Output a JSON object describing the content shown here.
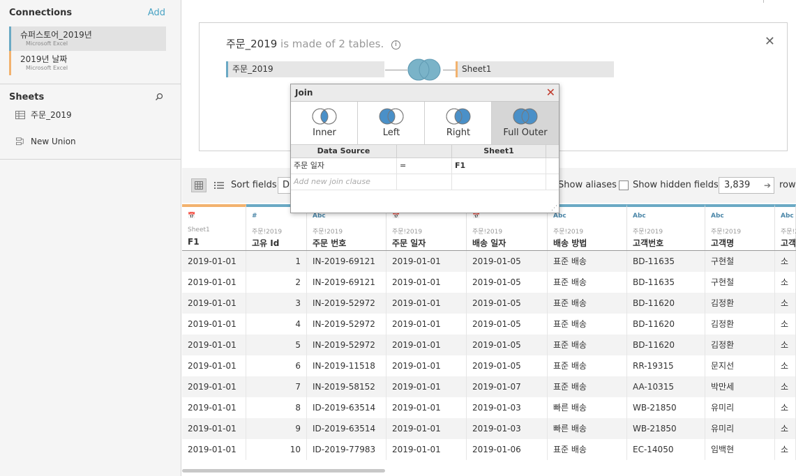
{
  "sidebar": {
    "connections_title": "Connections",
    "add_label": "Add",
    "connections": [
      {
        "name": "슈퍼스토어_2019년",
        "type": "Microsoft Excel"
      },
      {
        "name": "2019년 날짜",
        "type": "Microsoft Excel"
      }
    ],
    "sheets_title": "Sheets",
    "sheets": [
      {
        "name": "주문_2019",
        "icon": "grid-table-icon"
      },
      {
        "name": "New Union",
        "icon": "union-icon"
      }
    ]
  },
  "canvas": {
    "title_name": "주문_2019",
    "title_suffix": " is made of 2 tables.",
    "info_glyph": "i",
    "left_table": "주문_2019",
    "right_table": "Sheet1",
    "close_glyph": "✕"
  },
  "join_dialog": {
    "title": "Join",
    "close_glyph": "✕",
    "types": [
      {
        "label": "Inner",
        "selected": false
      },
      {
        "label": "Left",
        "selected": false
      },
      {
        "label": "Right",
        "selected": false
      },
      {
        "label": "Full Outer",
        "selected": true
      }
    ],
    "columns": {
      "left": "Data Source",
      "op": "",
      "right": "Sheet1"
    },
    "clauses": [
      {
        "left": "주문 일자",
        "op": "=",
        "right": "F1"
      }
    ],
    "add_clause_placeholder": "Add new join clause",
    "grip_glyph": "⋰"
  },
  "toolbar": {
    "sort_label": "Sort fields",
    "sort_value": "D",
    "show_aliases_label": "Show aliases",
    "show_hidden_label": "Show hidden fields",
    "show_hidden_checked": false,
    "rows_value": "3,839",
    "rows_arrow": "➔",
    "rows_label": "rows"
  },
  "grid": {
    "columns": [
      {
        "type_icon": "📅",
        "source": "Sheet1",
        "name": "F1",
        "sheet1": true
      },
      {
        "type_icon": "#",
        "source": "주문!2019",
        "name": "고유 Id",
        "sheet1": false
      },
      {
        "type_icon": "Abc",
        "source": "주문!2019",
        "name": "주문 번호",
        "sheet1": false
      },
      {
        "type_icon": "📅",
        "source": "주문!2019",
        "name": "주문 일자",
        "sheet1": false
      },
      {
        "type_icon": "📅",
        "source": "주문!2019",
        "name": "배송 일자",
        "sheet1": false
      },
      {
        "type_icon": "Abc",
        "source": "주문!2019",
        "name": "배송 방법",
        "sheet1": false
      },
      {
        "type_icon": "Abc",
        "source": "주문!2019",
        "name": "고객번호",
        "sheet1": false
      },
      {
        "type_icon": "Abc",
        "source": "주문!2019",
        "name": "고객명",
        "sheet1": false
      },
      {
        "type_icon": "Abc",
        "source": "주문!2019",
        "name": "고객",
        "sheet1": false
      }
    ],
    "rows": [
      [
        "2019-01-01",
        "1",
        "IN-2019-69121",
        "2019-01-01",
        "2019-01-05",
        "표준 배송",
        "BD-11635",
        "구현철",
        "소"
      ],
      [
        "2019-01-01",
        "2",
        "IN-2019-69121",
        "2019-01-01",
        "2019-01-05",
        "표준 배송",
        "BD-11635",
        "구현철",
        "소"
      ],
      [
        "2019-01-01",
        "3",
        "IN-2019-52972",
        "2019-01-01",
        "2019-01-05",
        "표준 배송",
        "BD-11620",
        "김정환",
        "소"
      ],
      [
        "2019-01-01",
        "4",
        "IN-2019-52972",
        "2019-01-01",
        "2019-01-05",
        "표준 배송",
        "BD-11620",
        "김정환",
        "소"
      ],
      [
        "2019-01-01",
        "5",
        "IN-2019-52972",
        "2019-01-01",
        "2019-01-05",
        "표준 배송",
        "BD-11620",
        "김정환",
        "소"
      ],
      [
        "2019-01-01",
        "6",
        "IN-2019-11518",
        "2019-01-01",
        "2019-01-05",
        "표준 배송",
        "RR-19315",
        "문지선",
        "소"
      ],
      [
        "2019-01-01",
        "7",
        "IN-2019-58152",
        "2019-01-01",
        "2019-01-07",
        "표준 배송",
        "AA-10315",
        "박만세",
        "소"
      ],
      [
        "2019-01-01",
        "8",
        "ID-2019-63514",
        "2019-01-01",
        "2019-01-03",
        "빠른 배송",
        "WB-21850",
        "유미리",
        "소"
      ],
      [
        "2019-01-01",
        "9",
        "ID-2019-63514",
        "2019-01-01",
        "2019-01-03",
        "빠른 배송",
        "WB-21850",
        "유미리",
        "소"
      ],
      [
        "2019-01-01",
        "10",
        "ID-2019-77983",
        "2019-01-01",
        "2019-01-06",
        "표준 배송",
        "EC-14050",
        "임백현",
        "소"
      ]
    ]
  },
  "colors": {
    "accent": "#4aa3c4",
    "primary_table": "#6aa9c4",
    "secondary_table": "#f2b26e",
    "venn_fill": "#4a90c8"
  }
}
